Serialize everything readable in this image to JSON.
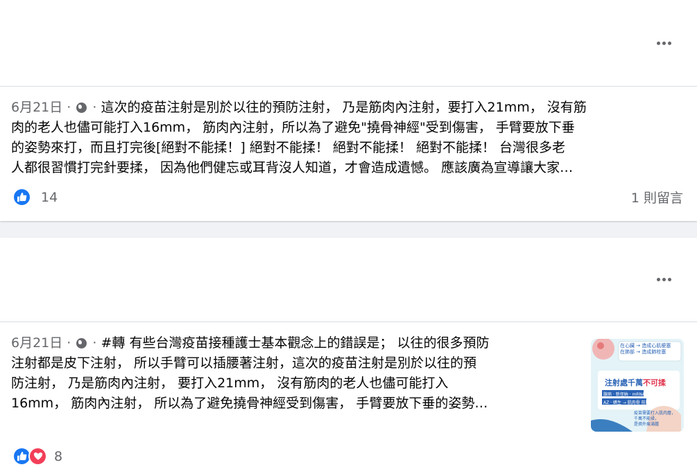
{
  "post1": {
    "date": "6月21日",
    "sep1": " · ",
    "sep2": " · ",
    "lines": [
      "這次的疫苗注射是別於以往的預防注射， 乃是筋肉內注射，要打入21mm， 沒有筋",
      "肉的老人也儘可能打入16mm， 筋肉內注射，所以為了避免\"撓骨神經\"受到傷害， 手臂要放下垂",
      "的姿勢來打，而且打完後[絕對不能揉！] 絕對不能揉！ 絕對不能揉！ 絕對不能揉！ 台灣很多老",
      "人都很習慣打完針要揉， 因為他們健忘或耳背沒人知道，才會造成遺憾。 應該廣為宣導讓大家…"
    ],
    "reaction_count": "14",
    "comments": "1 則留言"
  },
  "post2": {
    "date": "6月21日",
    "sep1": " · ",
    "sep2": " · ",
    "lines": [
      "#轉 有些台灣疫苗接種護士基本觀念上的錯誤是； 以往的很多預防",
      "注射都是皮下注射， 所以手臂可以插腰著注射，這次的疫苗注射是別於以往的預",
      "防注射， 乃是筋肉內注射， 要打入21mm， 沒有筋肉的老人也儘可能打入",
      "16mm， 筋肉內注射， 所以為了避免撓骨神經受到傷害， 手臂要放下垂的姿勢…"
    ],
    "reaction_count": "8",
    "thumbnail": {
      "caption_title": "注射處千萬",
      "caption_red": "不可揉",
      "bubble_lines": [
        "在心臟 → 造成心肌梗塞",
        "在肺部 → 造成肺栓塞"
      ],
      "labels": [
        "腺病 · 新徑納 · mRNA疫苗",
        "AZ · 嬌生 → 肌肉骨 前腿注射"
      ],
      "bottom_lines": [
        "疫苗需要打入肌肉層，",
        "千萬不能揉，",
        "是擠外痕滿腫"
      ]
    }
  },
  "icons": {
    "more": "more-icon",
    "globe": "globe-icon",
    "like": "like-icon",
    "love": "love-icon"
  },
  "colors": {
    "like_blue": "#1877f2",
    "love_red": "#f33e58",
    "meta_gray": "#65676b",
    "background": "#f0f2f5"
  }
}
